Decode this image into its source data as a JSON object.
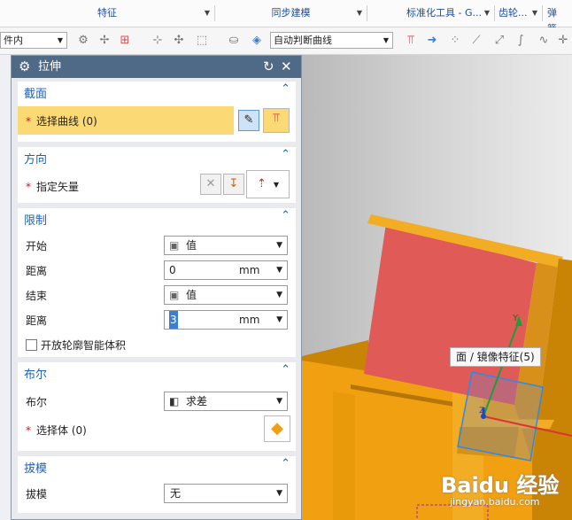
{
  "ribbon": {
    "groups": [
      {
        "label": "特征",
        "has_dropdown": true
      },
      {
        "label": "同步建模",
        "has_dropdown": true
      },
      {
        "label": "标准化工具 - G...",
        "has_dropdown": true
      },
      {
        "label": "齿轮...",
        "has_dropdown": true
      },
      {
        "label": "弹簧...",
        "has_dropdown": false
      }
    ]
  },
  "toolbar": {
    "filter_combo": "件内",
    "curve_rule_combo": "自动判断曲线"
  },
  "dialog": {
    "title": "拉伸",
    "sections": {
      "section": {
        "title": "截面",
        "select_curve_label": "选择曲线 (0)"
      },
      "direction": {
        "title": "方向",
        "specify_vector_label": "指定矢量"
      },
      "limits": {
        "title": "限制",
        "start_label": "开始",
        "start_value": "值",
        "start_distance_label": "距离",
        "start_distance": "0",
        "start_unit": "mm",
        "end_label": "结束",
        "end_value": "值",
        "end_distance_label": "距离",
        "end_distance": "3",
        "end_unit": "mm",
        "open_profile_label": "开放轮廓智能体积"
      },
      "boolean": {
        "title": "布尔",
        "boolean_label": "布尔",
        "boolean_value": "求差",
        "select_body_label": "选择体 (0)"
      },
      "draft": {
        "title": "拔模",
        "draft_label": "拔模",
        "draft_value": "无"
      }
    }
  },
  "viewport": {
    "tooltip": "面 / 镜像特征(5)",
    "axis_y_label": "Y",
    "axis_z_label": "Z"
  },
  "watermark": {
    "brand": "Baidu 经验",
    "url": "jingyan.baidu.com"
  },
  "colors": {
    "model_orange": "#f0a010",
    "model_face_red": "#e05a58",
    "accent_blue": "#1f62b7",
    "title_bar": "#4e6a86",
    "selection_yellow": "#fbd975"
  }
}
